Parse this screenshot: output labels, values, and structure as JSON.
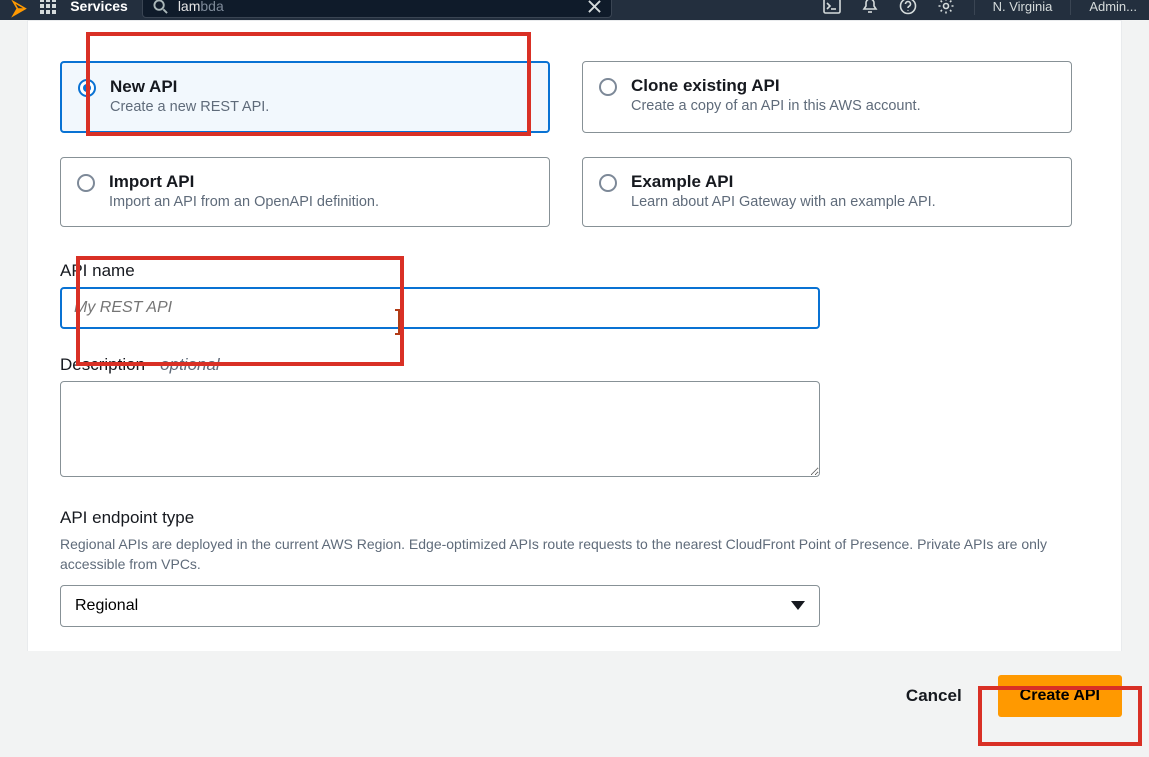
{
  "topnav": {
    "services_label": "Services",
    "search_typed": "lam",
    "search_suggestion": "bda",
    "region": "N. Virginia",
    "account": "Admin..."
  },
  "tiles": [
    {
      "title": "New API",
      "desc": "Create a new REST API.",
      "selected": true
    },
    {
      "title": "Clone existing API",
      "desc": "Create a copy of an API in this AWS account.",
      "selected": false
    },
    {
      "title": "Import API",
      "desc": "Import an API from an OpenAPI definition.",
      "selected": false
    },
    {
      "title": "Example API",
      "desc": "Learn about API Gateway with an example API.",
      "selected": false
    }
  ],
  "form": {
    "api_name_label": "API name",
    "api_name_placeholder": "My REST API",
    "api_name_value": "",
    "description_label": "Description",
    "description_optional": " - optional",
    "description_value": "",
    "endpoint_label": "API endpoint type",
    "endpoint_helper": "Regional APIs are deployed in the current AWS Region. Edge-optimized APIs route requests to the nearest CloudFront Point of Presence. Private APIs are only accessible from VPCs.",
    "endpoint_selected": "Regional"
  },
  "actions": {
    "cancel": "Cancel",
    "submit": "Create API"
  }
}
